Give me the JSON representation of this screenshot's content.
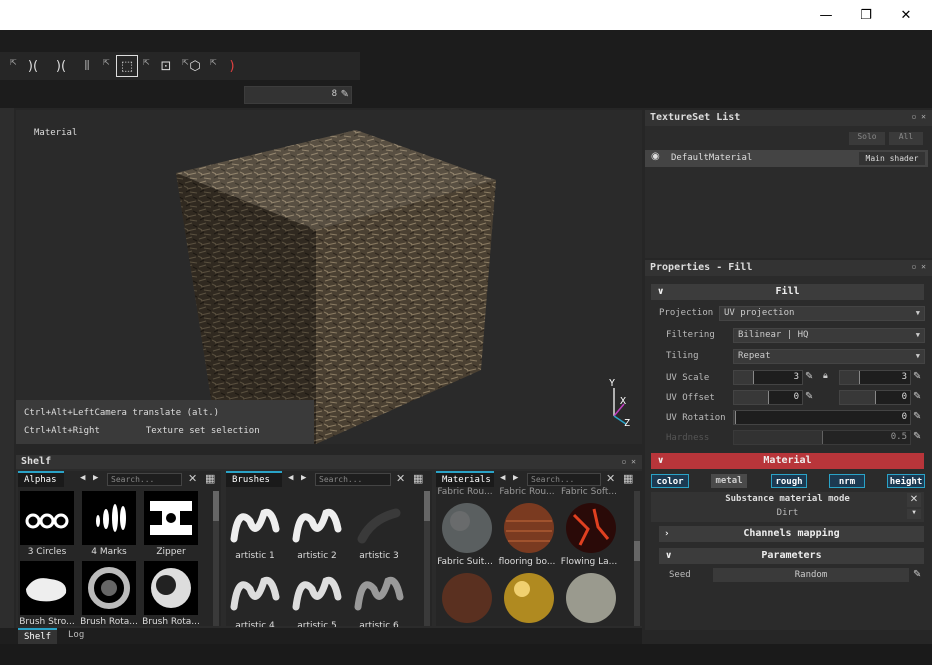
{
  "window": {
    "minimize": "—",
    "maximize": "❐",
    "close": "✕"
  },
  "toolbar": {
    "slider_value": "8"
  },
  "viewport": {
    "label": "Material",
    "hint1_key": "Ctrl+Alt+Left",
    "hint1_text": "Camera translate (alt.)",
    "hint2_key": "Ctrl+Alt+Right",
    "hint2_text": "Texture set selection",
    "gizmo": {
      "y": "Y",
      "x": "X",
      "z": "Z"
    }
  },
  "shelf": {
    "title": "Shelf",
    "alphas": {
      "tab": "Alphas",
      "search": "Search...",
      "items": [
        "3 Circles",
        "4 Marks",
        "Zipper",
        "Brush Stro...",
        "Brush Rota...",
        "Brush Rota..."
      ]
    },
    "brushes": {
      "tab": "Brushes",
      "search": "Search...",
      "items": [
        "artistic 1",
        "artistic 2",
        "artistic 3",
        "artistic 4",
        "artistic 5",
        "artistic 6"
      ]
    },
    "materials": {
      "tab": "Materials",
      "search": "Search...",
      "top": [
        "Fabric Rou...",
        "Fabric Rou...",
        "Fabric Soft..."
      ],
      "items": [
        "Fabric Suit...",
        "flooring bo...",
        "Flowing La..."
      ]
    }
  },
  "bottomtabs": {
    "shelf": "Shelf",
    "log": "Log"
  },
  "textureset": {
    "title": "TextureSet List",
    "solo": "Solo",
    "all": "All",
    "item": "DefaultMaterial",
    "shader": "Main shader"
  },
  "properties": {
    "title": "Properties - Fill",
    "fill_section": "Fill",
    "projection_label": "Projection",
    "projection_value": "UV projection",
    "filtering_label": "Filtering",
    "filtering_value": "Bilinear | HQ",
    "tiling_label": "Tiling",
    "tiling_value": "Repeat",
    "uvscale_label": "UV Scale",
    "uvscale_a": "3",
    "uvscale_b": "3",
    "uvoffset_label": "UV Offset",
    "uvoffset_a": "0",
    "uvoffset_b": "0",
    "uvrotation_label": "UV Rotation",
    "uvrotation_value": "0",
    "hardness_label": "Hardness",
    "hardness_value": "0.5",
    "material_section": "Material",
    "channels": [
      "color",
      "metal",
      "rough",
      "nrm",
      "height"
    ],
    "substance_mode": "Substance material mode",
    "substance_value": "Dirt",
    "channels_mapping": "Channels mapping",
    "parameters": "Parameters",
    "seed_label": "Seed",
    "seed_value": "Random"
  },
  "colors": {
    "accent": "#2aa3c7",
    "material_header": "#b8353a"
  }
}
